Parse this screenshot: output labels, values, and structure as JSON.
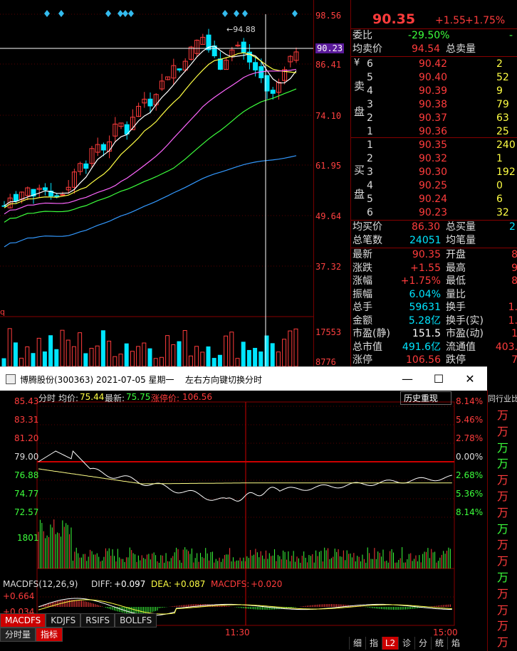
{
  "kline": {
    "price_ticks": [
      "98.56",
      "86.41",
      "74.10",
      "61.95",
      "49.64",
      "37.32"
    ],
    "crosshair_price": "90.23",
    "high_marker": "94.88",
    "volume_ticks": [
      "17553",
      "8776"
    ],
    "left_edge_label": "q"
  },
  "quote": {
    "price": "90.35",
    "change": "+1.55",
    "change_pct": "+1.75%",
    "weibi_label": "委比",
    "weibi_value": "-29.50%",
    "weibi_right": "-",
    "avg_sell_label": "均卖价",
    "avg_sell_value": "94.54",
    "total_sell_label": "总卖量",
    "sell_side_labels": [
      "¥",
      "卖",
      "盘"
    ],
    "sell": [
      {
        "lvl": "6",
        "price": "90.42",
        "vol": "2"
      },
      {
        "lvl": "5",
        "price": "90.40",
        "vol": "52"
      },
      {
        "lvl": "4",
        "price": "90.39",
        "vol": "9"
      },
      {
        "lvl": "3",
        "price": "90.38",
        "vol": "79"
      },
      {
        "lvl": "2",
        "price": "90.37",
        "vol": "63"
      },
      {
        "lvl": "1",
        "price": "90.36",
        "vol": "25"
      }
    ],
    "buy_side_labels": [
      "买",
      "盘"
    ],
    "buy": [
      {
        "lvl": "1",
        "price": "90.35",
        "vol": "240"
      },
      {
        "lvl": "2",
        "price": "90.32",
        "vol": "1"
      },
      {
        "lvl": "3",
        "price": "90.30",
        "vol": "192"
      },
      {
        "lvl": "4",
        "price": "90.25",
        "vol": "0"
      },
      {
        "lvl": "5",
        "price": "90.24",
        "vol": "6"
      },
      {
        "lvl": "6",
        "price": "90.23",
        "vol": "32"
      }
    ],
    "avg_buy_label": "均买价",
    "avg_buy_value": "86.30",
    "total_buy_label": "总买量",
    "total_buy_right": "2",
    "deals_label": "总笔数",
    "deals_value": "24051",
    "avg_deal_label": "均笔量",
    "stats": [
      {
        "l": "最新",
        "v": "90.35",
        "l2": "开盘",
        "v2": "8",
        "c": "red"
      },
      {
        "l": "涨跌",
        "v": "+1.55",
        "l2": "最高",
        "v2": "9",
        "c": "red"
      },
      {
        "l": "涨幅",
        "v": "+1.75%",
        "l2": "最低",
        "v2": "8",
        "c": "red"
      },
      {
        "l": "振幅",
        "v": "6.04%",
        "l2": "量比",
        "v2": "",
        "c": "cy"
      },
      {
        "l": "总手",
        "v": "59631",
        "l2": "换手",
        "v2": "1.",
        "c": "cy"
      },
      {
        "l": "金额",
        "v": "5.28亿",
        "l2": "换手(实)",
        "v2": "1.",
        "c": "cy"
      },
      {
        "l": "市盈(静)",
        "v": "151.5",
        "l2": "市盈(动)",
        "v2": "1",
        "c": "wht"
      },
      {
        "l": "总市值",
        "v": "491.6亿",
        "l2": "流通值",
        "v2": "403.",
        "c": "cy"
      },
      {
        "l": "涨停",
        "v": "106.56",
        "l2": "跌停",
        "v2": "7",
        "c": "red"
      }
    ]
  },
  "window": {
    "title": "博腾股份(300363) 2021-07-05 星期一",
    "hint": "左右方向键切换分时",
    "min": "—",
    "max": "☐",
    "close": "✕"
  },
  "intraday": {
    "header_prefix": "分时",
    "avg_label": "均价:",
    "avg_value": "75.44",
    "last_label": "最新:",
    "last_value": "75.75",
    "limit_label": "涨停价:",
    "limit_value": "106.56",
    "history_button": "历史重现",
    "left_ticks": [
      "85.43",
      "83.31",
      "81.20",
      "79.00",
      "76.88",
      "74.77",
      "72.57"
    ],
    "right_ticks": [
      "8.14%",
      "5.46%",
      "2.78%",
      "0.00%",
      "2.68%",
      "5.36%",
      "8.14%"
    ],
    "volume_tick": "1801",
    "macd_label": "MACDFS(12,26,9)",
    "diff_label": "DIFF:",
    "diff_value": "+0.097",
    "dea_label": "DEA:",
    "dea_value": "+0.087",
    "macd_label2": "MACDFS:",
    "macd_value": "+0.020",
    "macd_ticks": [
      "+0.664",
      "+0.034"
    ],
    "time_ticks": [
      "09:30",
      "11:30",
      "15:00"
    ],
    "tabs": [
      "MACDFS",
      "KDJFS",
      "RSIFS",
      "BOLLFS"
    ],
    "subtabs": [
      "分时量",
      "指标"
    ]
  },
  "right_strip": {
    "header": "同行业比",
    "wan": [
      "万",
      "万",
      "万",
      "万",
      "万",
      "万",
      "万",
      "万",
      "万",
      "万",
      "万",
      "万",
      "万",
      "万",
      "万"
    ]
  },
  "bottom_bar": [
    "细",
    "指",
    "L2",
    "诊",
    "分",
    "统",
    "焰"
  ],
  "colors": {
    "up": "#ff3c3c",
    "down": "#3cff3c",
    "price": "#ffff44",
    "info": "#00e5ff"
  }
}
